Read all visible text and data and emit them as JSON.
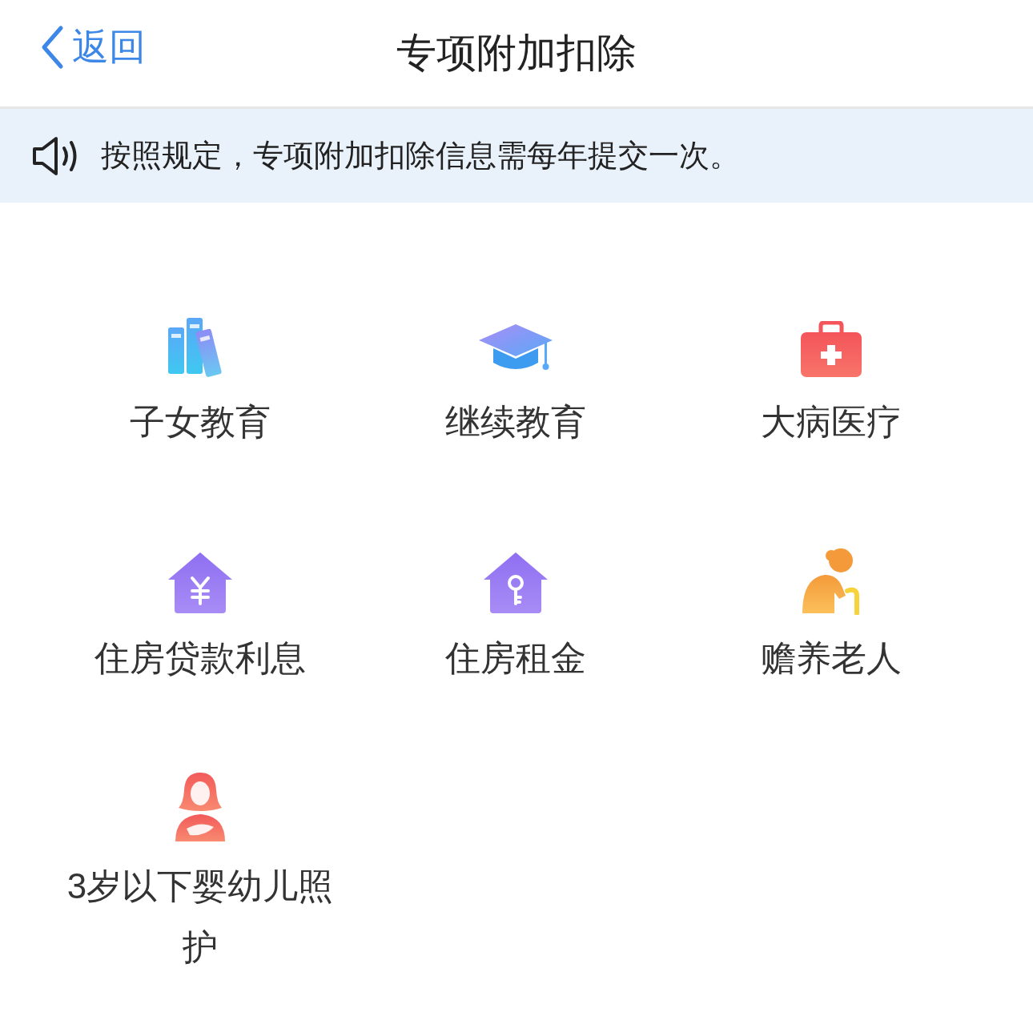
{
  "header": {
    "back_label": "返回",
    "title": "专项附加扣除"
  },
  "notice": {
    "text": "按照规定，专项附加扣除信息需每年提交一次。"
  },
  "items": [
    {
      "label": "子女教育"
    },
    {
      "label": "继续教育"
    },
    {
      "label": "大病医疗"
    },
    {
      "label": "住房贷款利息"
    },
    {
      "label": "住房租金"
    },
    {
      "label": "赡养老人"
    },
    {
      "label": "3岁以下婴幼儿照护"
    }
  ]
}
